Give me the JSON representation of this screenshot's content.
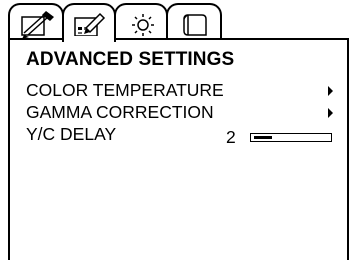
{
  "tabs": [
    {
      "icon": "picture-adjust-icon",
      "selected": false
    },
    {
      "icon": "image-edit-icon",
      "selected": true
    },
    {
      "icon": "settings-sun-icon",
      "selected": false
    },
    {
      "icon": "page-icon",
      "selected": false
    }
  ],
  "menu": {
    "title": "ADVANCED SETTINGS",
    "items": [
      {
        "label": "COLOR TEMPERATURE",
        "has_submenu": true
      },
      {
        "label": "GAMMA CORRECTION",
        "has_submenu": true
      },
      {
        "label": "Y/C DELAY",
        "value": "2",
        "level": 0.25
      }
    ]
  },
  "colors": {
    "foreground": "#000000",
    "background": "#ffffff"
  }
}
